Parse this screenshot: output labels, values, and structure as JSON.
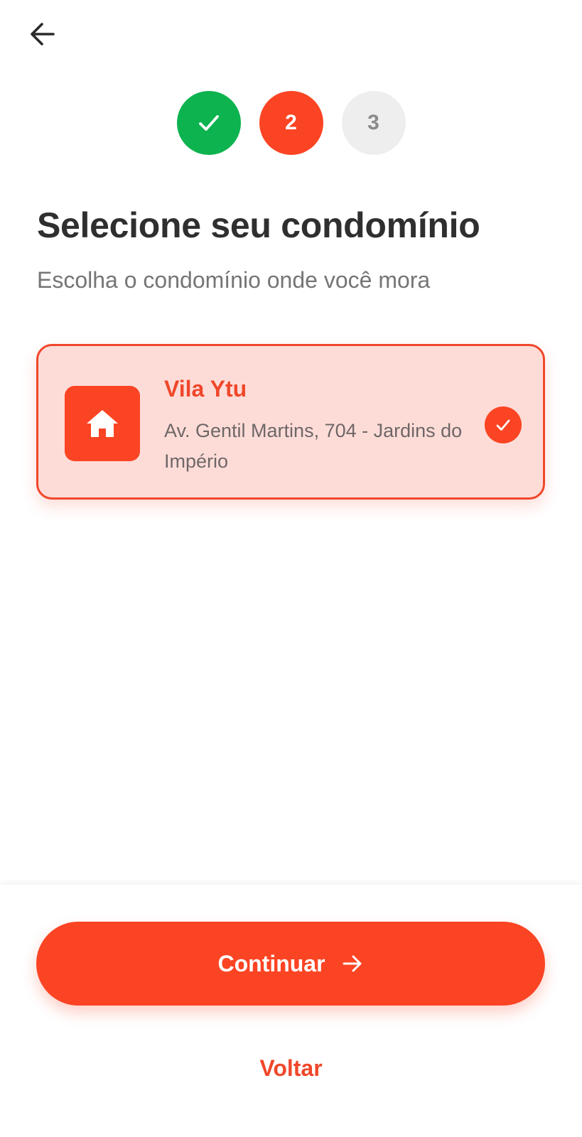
{
  "nav": {
    "back_icon": "arrow-left-icon"
  },
  "stepper": {
    "steps": [
      {
        "label": "",
        "state": "done",
        "icon": "check-icon"
      },
      {
        "label": "2",
        "state": "active"
      },
      {
        "label": "3",
        "state": "pending"
      }
    ],
    "current_step": 2
  },
  "header": {
    "title": "Selecione seu condomínio",
    "subtitle": "Escolha o condomínio onde você mora"
  },
  "condominiums": [
    {
      "name": "Vila Ytu",
      "address": "Av. Gentil Martins, 704 - Jardins do Império",
      "icon": "home-icon",
      "selected": true
    }
  ],
  "footer": {
    "continue_label": "Continuar",
    "continue_icon": "arrow-right-icon",
    "back_label": "Voltar"
  },
  "colors": {
    "primary": "#fb4423",
    "success": "#0db34f",
    "selected_background": "#fddcd8",
    "title_text": "#2f2f2f",
    "muted_text": "#757575",
    "pending_step": "#eeeeee"
  }
}
